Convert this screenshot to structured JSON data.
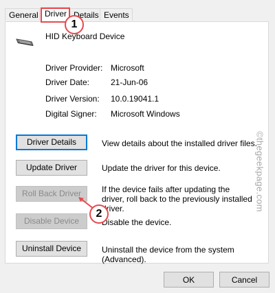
{
  "tabs": [
    "General",
    "Driver",
    "Details",
    "Events"
  ],
  "active_tab": "Driver",
  "device": {
    "name": "HID Keyboard Device",
    "icon": "keyboard-icon"
  },
  "info": [
    {
      "label": "Driver Provider:",
      "value": "Microsoft"
    },
    {
      "label": "Driver Date:",
      "value": "21-Jun-06"
    },
    {
      "label": "Driver Version:",
      "value": "10.0.19041.1"
    },
    {
      "label": "Digital Signer:",
      "value": "Microsoft Windows"
    }
  ],
  "actions": [
    {
      "label": "Driver Details",
      "description": "View details about the installed driver files.",
      "enabled": true
    },
    {
      "label": "Update Driver",
      "description": "Update the driver for this device.",
      "enabled": true
    },
    {
      "label": "Roll Back Driver",
      "description": "If the device fails after updating the driver, roll back to the previously installed driver.",
      "enabled": false
    },
    {
      "label": "Disable Device",
      "description": "Disable the device.",
      "enabled": false
    },
    {
      "label": "Uninstall Device",
      "description": "Uninstall the device from the system (Advanced).",
      "enabled": true
    }
  ],
  "footer": {
    "ok": "OK",
    "cancel": "Cancel"
  },
  "annotations": {
    "badge1": "1",
    "badge2": "2",
    "color": "#e8484d"
  },
  "watermark": "©thegeekpage.com"
}
